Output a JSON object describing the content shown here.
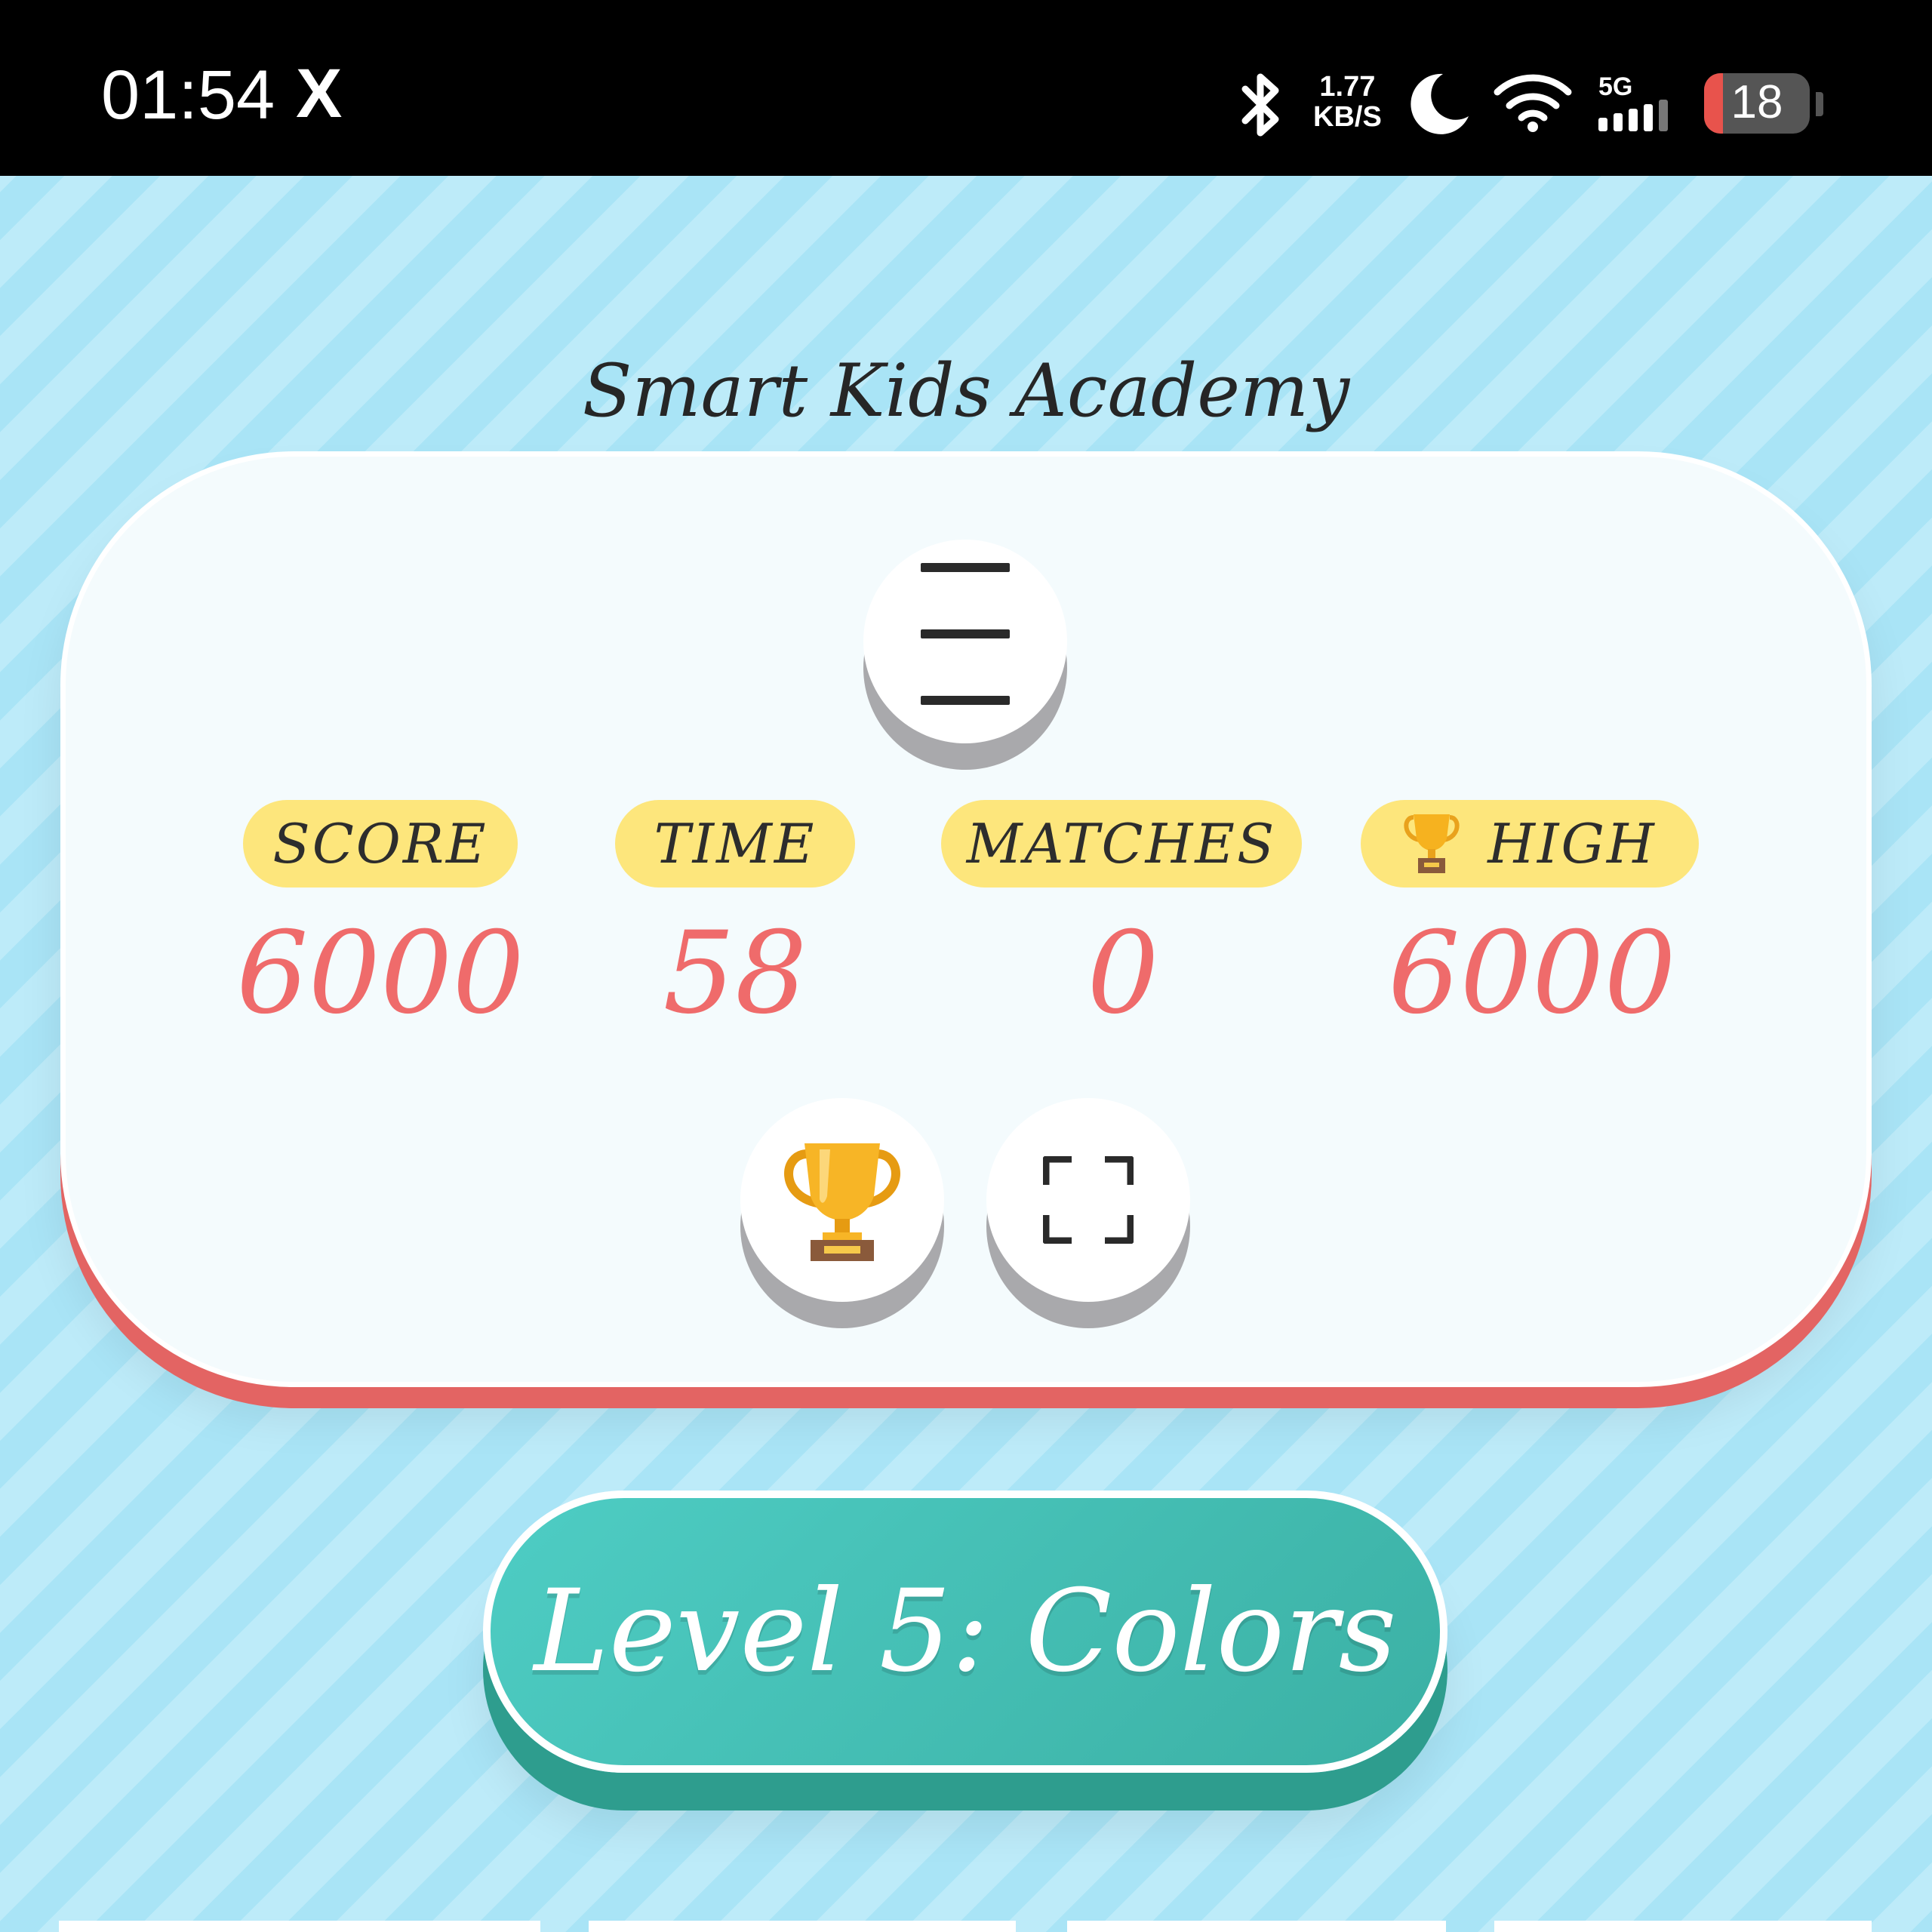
{
  "status_bar": {
    "time": "01:54",
    "app_icon": "X",
    "net_speed_value": "1.77",
    "net_speed_unit": "KB/S",
    "network": "5G",
    "battery": "18",
    "battery_level": 0.18,
    "icons": [
      "bluetooth-icon",
      "moon-icon",
      "wifi-icon",
      "signal-icon",
      "battery-icon"
    ]
  },
  "app": {
    "title": "Smart Kids Academy"
  },
  "stats": [
    {
      "label": "SCORE",
      "value": "6000"
    },
    {
      "label": "TIME",
      "value": "58"
    },
    {
      "label": "MATCHES",
      "value": "0"
    },
    {
      "label": "HIGH",
      "value": "6000",
      "icon": "trophy-icon"
    }
  ],
  "buttons": {
    "menu_icon": "hamburger-icon",
    "leaderboard_icon": "trophy-icon",
    "fullscreen_icon": "fullscreen-icon"
  },
  "level": {
    "label": "Level 5: Colors"
  },
  "colors": {
    "accent_teal": "#4ecdc4",
    "score_red": "#ef6b6b",
    "label_yellow": "#fde67c",
    "card_edge": "#e36463",
    "background": "#a9e4f6"
  }
}
